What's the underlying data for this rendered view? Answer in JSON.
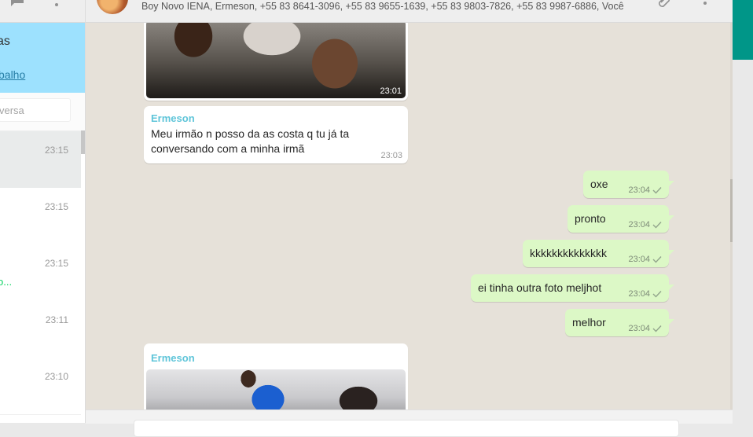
{
  "sidebar": {
    "notice_title": "as",
    "notice_link": "balho",
    "search_placeholder": "versa",
    "chats": [
      {
        "time": "23:15",
        "preview": ""
      },
      {
        "time": "23:15",
        "preview": ""
      },
      {
        "time": "23:15",
        "preview": "o..."
      },
      {
        "time": "23:11",
        "preview": ""
      },
      {
        "time": "23:10",
        "preview": ""
      }
    ]
  },
  "header": {
    "participants": "Boy Novo IENA, Ermeson, +55 83 8641-3096, +55 83 9655-1639, +55 83 9803-7826, +55 83 9987-6886, Você"
  },
  "messages": {
    "photo1_time": "23:01",
    "msg1_sender": "Ermeson",
    "msg1_text": "Meu irmão n posso da as costa q tu já ta conversando com a minha irmã",
    "msg1_time": "23:03",
    "outgoing": [
      {
        "text": "oxe",
        "time": "23:04"
      },
      {
        "text": "pronto",
        "time": "23:04"
      },
      {
        "text": "kkkkkkkkkkkkkk",
        "time": "23:04"
      },
      {
        "text": "ei tinha outra foto meljhot",
        "time": "23:04"
      },
      {
        "text": "melhor",
        "time": "23:04"
      }
    ],
    "msg2_sender": "Ermeson"
  },
  "colors": {
    "notice_bg": "#9de1fe",
    "sender_color": "#5fc5d9",
    "outgoing_bubble": "#dcf8c6",
    "chat_background": "#e6e1d9",
    "accent_teal": "#009688",
    "unread_preview": "#09d261"
  },
  "icons": {
    "sidebar_chat": "chat-icon",
    "sidebar_menu": "menu-icon",
    "header_attach": "paperclip-icon",
    "header_menu": "menu-icon",
    "status": "single-check-icon"
  }
}
